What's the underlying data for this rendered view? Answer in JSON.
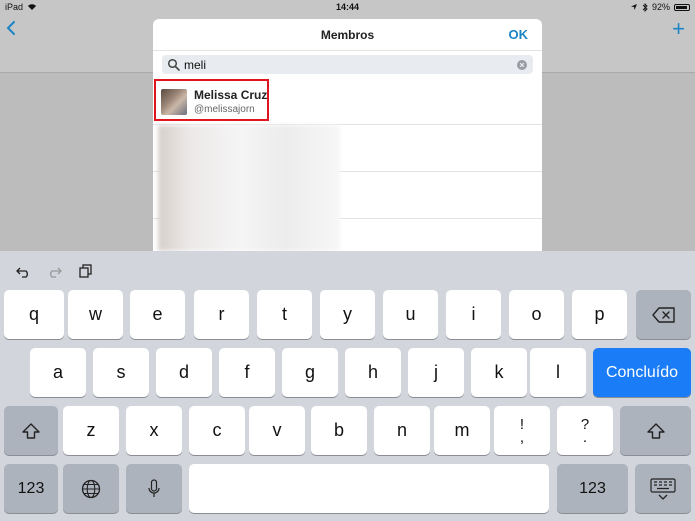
{
  "status": {
    "device": "iPad",
    "time": "14:44",
    "battery": "92%",
    "battery_level": 0.92
  },
  "app": {
    "back_icon": "chevron-left-icon",
    "add_label": "+"
  },
  "modal": {
    "title": "Membros",
    "ok_label": "OK",
    "search": {
      "value": "meli",
      "placeholder": ""
    },
    "results": [
      {
        "name": "Melissa Cruz",
        "handle": "@melissajorn"
      }
    ]
  },
  "keyboard": {
    "row1": [
      "q",
      "w",
      "e",
      "r",
      "t",
      "y",
      "u",
      "i",
      "o",
      "p"
    ],
    "row2": [
      "a",
      "s",
      "d",
      "f",
      "g",
      "h",
      "j",
      "k",
      "l"
    ],
    "row3": [
      "z",
      "x",
      "c",
      "v",
      "b",
      "n",
      "m"
    ],
    "done_label": "Concluído",
    "num_label": "123",
    "punct1": [
      "!",
      ","
    ],
    "punct2": [
      "?",
      "."
    ],
    "accent": "#1a7cf6"
  }
}
